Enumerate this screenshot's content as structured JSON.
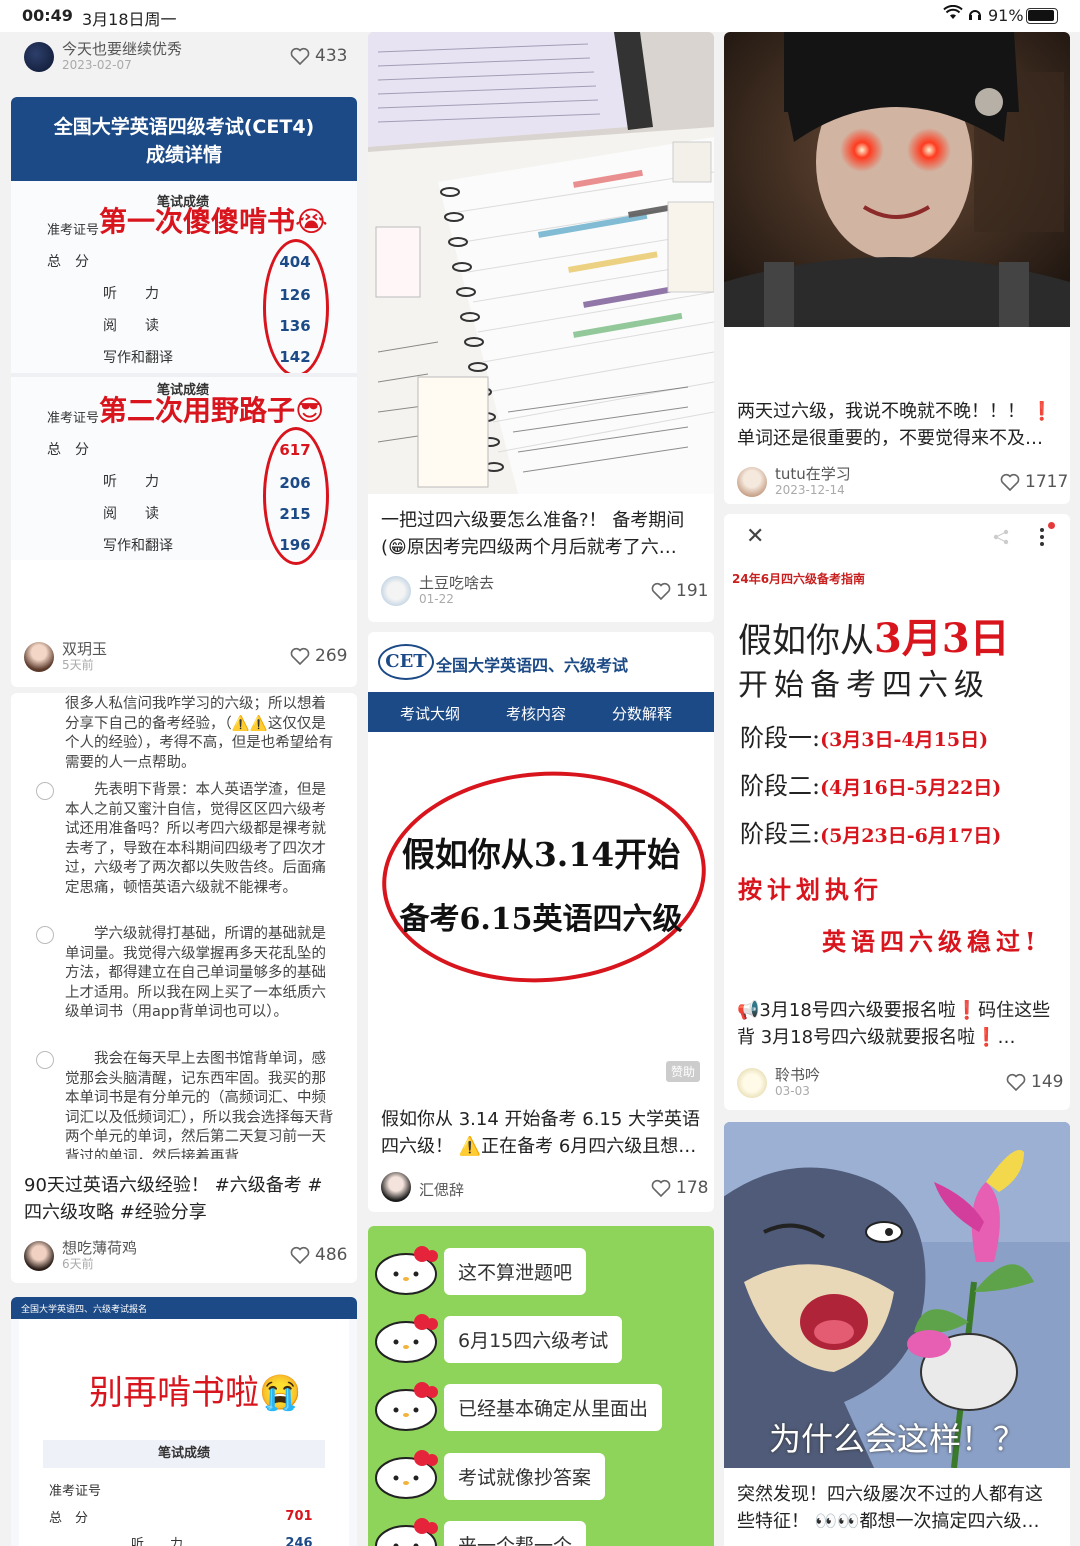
{
  "status_bar": {
    "time": "00:49",
    "date": "3月18日周一",
    "battery": "91%"
  },
  "col1": {
    "post0": {
      "user": "今天也要继续优秀",
      "date": "2023-02-07",
      "likes": "433"
    },
    "post1": {
      "header": [
        "全国大学英语四级考试(CET4)",
        "成绩详情"
      ],
      "section_label": "笔试成绩",
      "id_label": "准考证号",
      "red_title_1": "第一次傻傻啃书😭",
      "red_title_2": "第二次用野路子😎",
      "rows": [
        "总　分",
        "听　　力",
        "阅　　读",
        "写作和翻译"
      ],
      "scores_1": [
        "404",
        "126",
        "136",
        "142"
      ],
      "scores_2": [
        "617",
        "206",
        "215",
        "196"
      ],
      "user": "双玥玉",
      "date": "5天前",
      "likes": "269"
    },
    "post2": {
      "paragraphs": [
        "很多人私信问我咋学习的六级；所以想着分享下自己的备考经验，（⚠️⚠️这仅仅是个人的经验），考得不高，但是也希望给有需要的人一点帮助。",
        "先表明下背景：本人英语学渣，但是本人之前又蜜汁自信，觉得区区四六级考试还用准备吗？所以考四六级都是裸考就去考了，导致在本科期间四级考了四次才过，六级考了两次都以失败告终。后面痛定思痛，顿悟英语六级就不能裸考。",
        "学六级就得打基础，所谓的基础就是单词量。我觉得六级掌握再多天花乱坠的方法，都得建立在自己单词量够多的基础上才适用。所以我在网上买了一本纸质六级单词书（用app背单词也可以）。",
        "我会在每天早上去图书馆背单词，感觉那会头脑清醒，记东西牢固。我买的那本单词书是有分单元的（高频词汇、中频词汇以及低频词汇），所以我会选择每天背两个单元的单词，然后第二天复习前一天背过的单词，然后接着再背"
      ],
      "title": "90天过英语六级经验！ #六级备考 # 四六级攻略 #经验分享",
      "user": "想吃薄荷鸡",
      "date": "6天前",
      "likes": "486"
    },
    "post3": {
      "header_small": "全国大学英语四、六级考试报名",
      "red_title": "别再啃书啦😭",
      "section_label": "笔试成绩",
      "id_label": "准考证号",
      "rows": [
        "总　分",
        "听　　力"
      ],
      "scores": [
        "701",
        "246"
      ]
    }
  },
  "col2": {
    "post0": {
      "title": "一把过四六级要怎么准备?！ 备考期间 (😁原因考完四级两个月后就考了六…",
      "user": "土豆吃啥去",
      "date": "01-22",
      "likes": "191"
    },
    "post1": {
      "logo": "CET",
      "brand": "全国大学英语四、六级考试",
      "tabs": [
        "考试大纲",
        "考核内容",
        "分数解释"
      ],
      "big_line_1": "假如你从3.14开始",
      "big_line_2": "备考6.15英语四六级",
      "badge": "赞助",
      "title": "假如你从 3.14 开始备考 6.15 大学英语四六级！ ⚠️正在备考 6月四六级且想…",
      "user": "汇偲辞",
      "likes": "178"
    },
    "post2": {
      "bubbles": [
        "这不算泄题吧",
        "6月15四六级考试",
        "已经基本确定从里面出",
        "考试就像抄答案",
        "来一个帮一个"
      ]
    }
  },
  "col3": {
    "post0": {
      "title": "两天过六级，我说不晚就不晚！！！ ❗️单词还是很重要的，不要觉得来不及…",
      "user": "tutu在学习",
      "date": "2023-12-14",
      "likes": "1717"
    },
    "post1": {
      "banner": "24年6月四六级备考指南",
      "line1_a": "假如你从",
      "line1_b": "3月3日",
      "line2": "开始备考四六级",
      "stage1_label": "阶段一:",
      "stage1_date": "(3月3日-4月15日)",
      "stage2_label": "阶段二:",
      "stage2_date": "(4月16日-5月22日)",
      "stage3_label": "阶段三:",
      "stage3_date": "(5月23日-6月17日)",
      "plan": "按计划执行",
      "pass": "英语四六级稳过!",
      "title": "📢3月18号四六级要报名啦❗️码住这些背 3月18号四六级就要报名啦❗️…",
      "user": "聆书吟",
      "date": "03-03",
      "likes": "149"
    },
    "post2": {
      "caption": "为什么会这样！？",
      "title": "突然发现！四六级屡次不过的人都有这些特征！ 👀👀都想一次搞定四六级…"
    }
  },
  "colors": {
    "cet_blue": "#1c4a86",
    "red": "#d8141d",
    "green": "#8ed35a"
  }
}
